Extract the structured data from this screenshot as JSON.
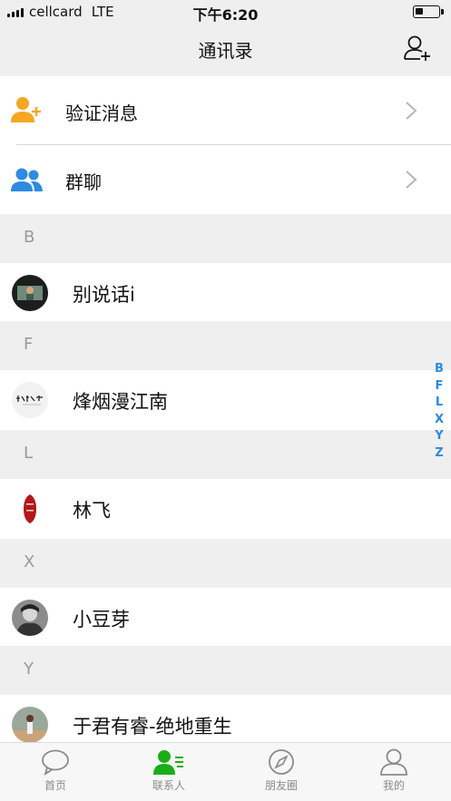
{
  "status_bar": {
    "carrier": "cellcard",
    "network": "LTE",
    "time": "下午6:20",
    "battery_level": 0.35
  },
  "nav": {
    "title": "通讯录",
    "add_contact_icon": "add-contact-icon"
  },
  "top_items": [
    {
      "label": "验证消息",
      "icon": "add-friend-icon",
      "icon_color": "#f5a623"
    },
    {
      "label": "群聊",
      "icon": "group-chat-icon",
      "icon_color": "#2d8be0"
    }
  ],
  "sections": [
    {
      "letter": "B",
      "contacts": [
        {
          "name": "别说话i"
        }
      ]
    },
    {
      "letter": "F",
      "contacts": [
        {
          "name": "烽烟漫江南"
        }
      ]
    },
    {
      "letter": "L",
      "contacts": [
        {
          "name": "林飞"
        }
      ]
    },
    {
      "letter": "X",
      "contacts": [
        {
          "name": "小豆芽"
        }
      ]
    },
    {
      "letter": "Y",
      "contacts": [
        {
          "name": "于君有睿-绝地重生"
        }
      ]
    }
  ],
  "index_letters": [
    "B",
    "F",
    "L",
    "X",
    "Y",
    "Z"
  ],
  "tabs": [
    {
      "label": "首页",
      "icon": "chat-bubble-icon",
      "active": false
    },
    {
      "label": "联系人",
      "icon": "contacts-icon",
      "active": true
    },
    {
      "label": "朋友圈",
      "icon": "compass-icon",
      "active": false
    },
    {
      "label": "我的",
      "icon": "profile-icon",
      "active": false
    }
  ],
  "colors": {
    "accent_green": "#1aad19",
    "index_blue": "#2d8be0",
    "section_gray": "#efefef"
  }
}
